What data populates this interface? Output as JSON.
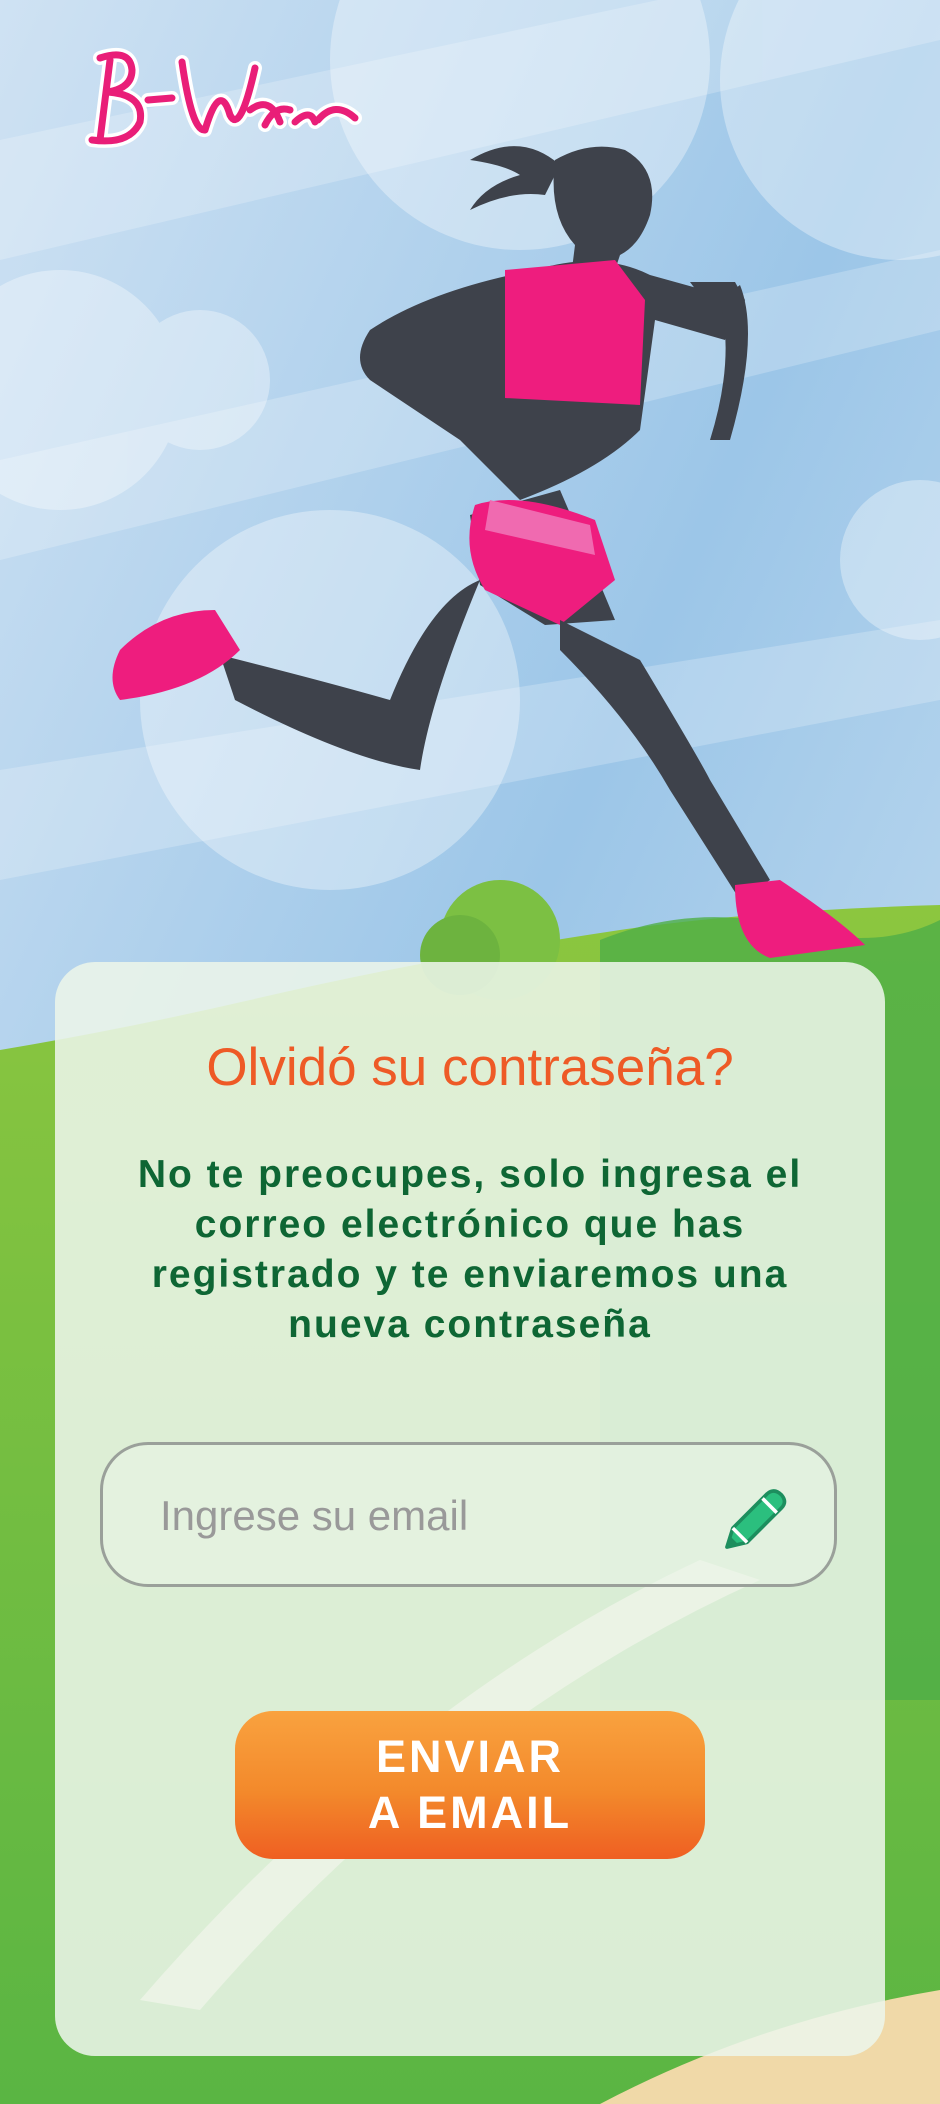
{
  "brand": {
    "logo_text": "B-Ware"
  },
  "form": {
    "title": "Olvidó su contraseña?",
    "message": "No te preocupes, solo ingresa el correo electrónico que has registrado y te enviaremos una nueva contraseña",
    "email_placeholder": "Ingrese su email",
    "email_value": "",
    "submit_label": "ENVIAR\nA EMAIL"
  },
  "colors": {
    "brand_pink": "#e91e78",
    "title_orange": "#ee5a26",
    "message_green": "#0e6634",
    "button_orange": "#f3892b",
    "pencil_green": "#2bbf7e"
  },
  "icons": {
    "edit": "pencil-icon"
  }
}
